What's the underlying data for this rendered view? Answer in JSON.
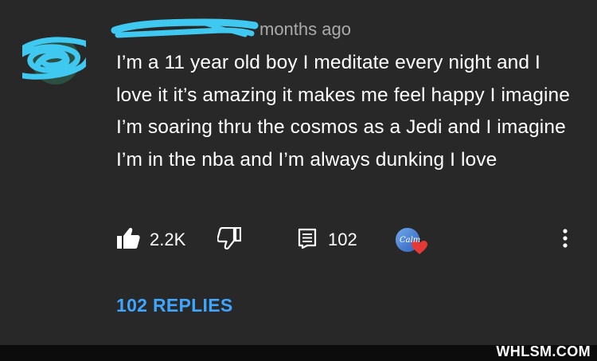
{
  "comment": {
    "time": "months ago",
    "text": "I’m a 11 year old boy I meditate every night and I love it it’s amazing it makes me feel happy I imagine I’m soaring thru the cosmos as a Jedi and I imagine I’m in the nba and I’m always dunking I love",
    "likes": "2.2K",
    "reply_count": "102",
    "replies_link": "102 REPLIES",
    "hearted_by_label": "Calm"
  },
  "icons": [
    "avatar",
    "thumbs-up-icon",
    "thumbs-down-icon",
    "reply-icon",
    "creator-heart-icon",
    "more-vert-icon"
  ],
  "colors": {
    "background": "#282828",
    "text": "#ffffff",
    "secondary_text": "#aaaaaa",
    "link": "#3ea6ff",
    "redaction_scribble": "#3fc8f0",
    "heart": "#e53935"
  },
  "watermark": "WHLSM.COM"
}
